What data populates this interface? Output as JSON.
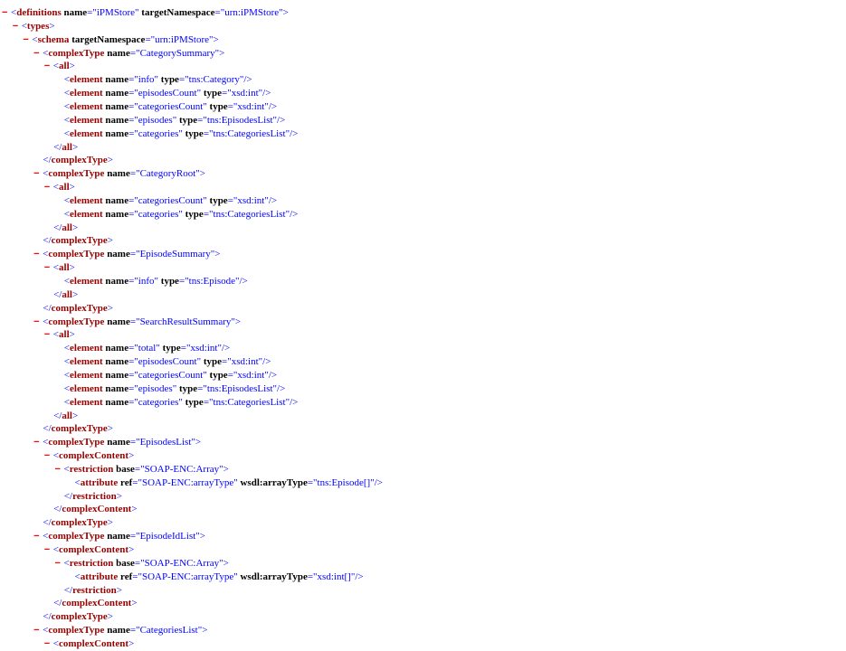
{
  "xml_lines": [
    {
      "d": 0,
      "toggle": true,
      "kind": "open",
      "tag": "definitions",
      "attrs": [
        [
          "name",
          "iPMStore"
        ],
        [
          "targetNamespace",
          "urn:iPMStore"
        ]
      ]
    },
    {
      "d": 1,
      "toggle": true,
      "kind": "open",
      "tag": "types",
      "attrs": []
    },
    {
      "d": 2,
      "toggle": true,
      "kind": "open",
      "tag": "schema",
      "attrs": [
        [
          "targetNamespace",
          "urn:iPMStore"
        ]
      ]
    },
    {
      "d": 3,
      "toggle": true,
      "kind": "open",
      "tag": "complexType",
      "attrs": [
        [
          "name",
          "CategorySummary"
        ]
      ]
    },
    {
      "d": 4,
      "toggle": true,
      "kind": "open",
      "tag": "all",
      "attrs": []
    },
    {
      "d": 5,
      "toggle": false,
      "kind": "empty",
      "tag": "element",
      "attrs": [
        [
          "name",
          "info"
        ],
        [
          "type",
          "tns:Category"
        ]
      ]
    },
    {
      "d": 5,
      "toggle": false,
      "kind": "empty",
      "tag": "element",
      "attrs": [
        [
          "name",
          "episodesCount"
        ],
        [
          "type",
          "xsd:int"
        ]
      ]
    },
    {
      "d": 5,
      "toggle": false,
      "kind": "empty",
      "tag": "element",
      "attrs": [
        [
          "name",
          "categoriesCount"
        ],
        [
          "type",
          "xsd:int"
        ]
      ]
    },
    {
      "d": 5,
      "toggle": false,
      "kind": "empty",
      "tag": "element",
      "attrs": [
        [
          "name",
          "episodes"
        ],
        [
          "type",
          "tns:EpisodesList"
        ]
      ]
    },
    {
      "d": 5,
      "toggle": false,
      "kind": "empty",
      "tag": "element",
      "attrs": [
        [
          "name",
          "categories"
        ],
        [
          "type",
          "tns:CategoriesList"
        ]
      ]
    },
    {
      "d": 4,
      "toggle": false,
      "kind": "close",
      "tag": "all",
      "attrs": []
    },
    {
      "d": 3,
      "toggle": false,
      "kind": "close",
      "tag": "complexType",
      "attrs": []
    },
    {
      "d": 3,
      "toggle": true,
      "kind": "open",
      "tag": "complexType",
      "attrs": [
        [
          "name",
          "CategoryRoot"
        ]
      ]
    },
    {
      "d": 4,
      "toggle": true,
      "kind": "open",
      "tag": "all",
      "attrs": []
    },
    {
      "d": 5,
      "toggle": false,
      "kind": "empty",
      "tag": "element",
      "attrs": [
        [
          "name",
          "categoriesCount"
        ],
        [
          "type",
          "xsd:int"
        ]
      ]
    },
    {
      "d": 5,
      "toggle": false,
      "kind": "empty",
      "tag": "element",
      "attrs": [
        [
          "name",
          "categories"
        ],
        [
          "type",
          "tns:CategoriesList"
        ]
      ]
    },
    {
      "d": 4,
      "toggle": false,
      "kind": "close",
      "tag": "all",
      "attrs": []
    },
    {
      "d": 3,
      "toggle": false,
      "kind": "close",
      "tag": "complexType",
      "attrs": []
    },
    {
      "d": 3,
      "toggle": true,
      "kind": "open",
      "tag": "complexType",
      "attrs": [
        [
          "name",
          "EpisodeSummary"
        ]
      ]
    },
    {
      "d": 4,
      "toggle": true,
      "kind": "open",
      "tag": "all",
      "attrs": []
    },
    {
      "d": 5,
      "toggle": false,
      "kind": "empty",
      "tag": "element",
      "attrs": [
        [
          "name",
          "info"
        ],
        [
          "type",
          "tns:Episode"
        ]
      ]
    },
    {
      "d": 4,
      "toggle": false,
      "kind": "close",
      "tag": "all",
      "attrs": []
    },
    {
      "d": 3,
      "toggle": false,
      "kind": "close",
      "tag": "complexType",
      "attrs": []
    },
    {
      "d": 3,
      "toggle": true,
      "kind": "open",
      "tag": "complexType",
      "attrs": [
        [
          "name",
          "SearchResultSummary"
        ]
      ]
    },
    {
      "d": 4,
      "toggle": true,
      "kind": "open",
      "tag": "all",
      "attrs": []
    },
    {
      "d": 5,
      "toggle": false,
      "kind": "empty",
      "tag": "element",
      "attrs": [
        [
          "name",
          "total"
        ],
        [
          "type",
          "xsd:int"
        ]
      ]
    },
    {
      "d": 5,
      "toggle": false,
      "kind": "empty",
      "tag": "element",
      "attrs": [
        [
          "name",
          "episodesCount"
        ],
        [
          "type",
          "xsd:int"
        ]
      ]
    },
    {
      "d": 5,
      "toggle": false,
      "kind": "empty",
      "tag": "element",
      "attrs": [
        [
          "name",
          "categoriesCount"
        ],
        [
          "type",
          "xsd:int"
        ]
      ]
    },
    {
      "d": 5,
      "toggle": false,
      "kind": "empty",
      "tag": "element",
      "attrs": [
        [
          "name",
          "episodes"
        ],
        [
          "type",
          "tns:EpisodesList"
        ]
      ]
    },
    {
      "d": 5,
      "toggle": false,
      "kind": "empty",
      "tag": "element",
      "attrs": [
        [
          "name",
          "categories"
        ],
        [
          "type",
          "tns:CategoriesList"
        ]
      ]
    },
    {
      "d": 4,
      "toggle": false,
      "kind": "close",
      "tag": "all",
      "attrs": []
    },
    {
      "d": 3,
      "toggle": false,
      "kind": "close",
      "tag": "complexType",
      "attrs": []
    },
    {
      "d": 3,
      "toggle": true,
      "kind": "open",
      "tag": "complexType",
      "attrs": [
        [
          "name",
          "EpisodesList"
        ]
      ]
    },
    {
      "d": 4,
      "toggle": true,
      "kind": "open",
      "tag": "complexContent",
      "attrs": []
    },
    {
      "d": 5,
      "toggle": true,
      "kind": "open",
      "tag": "restriction",
      "attrs": [
        [
          "base",
          "SOAP-ENC:Array"
        ]
      ]
    },
    {
      "d": 6,
      "toggle": false,
      "kind": "empty",
      "tag": "attribute",
      "attrs": [
        [
          "ref",
          "SOAP-ENC:arrayType"
        ],
        [
          "wsdl:arrayType",
          "tns:Episode[]"
        ]
      ]
    },
    {
      "d": 5,
      "toggle": false,
      "kind": "close",
      "tag": "restriction",
      "attrs": []
    },
    {
      "d": 4,
      "toggle": false,
      "kind": "close",
      "tag": "complexContent",
      "attrs": []
    },
    {
      "d": 3,
      "toggle": false,
      "kind": "close",
      "tag": "complexType",
      "attrs": []
    },
    {
      "d": 3,
      "toggle": true,
      "kind": "open",
      "tag": "complexType",
      "attrs": [
        [
          "name",
          "EpisodeIdList"
        ]
      ]
    },
    {
      "d": 4,
      "toggle": true,
      "kind": "open",
      "tag": "complexContent",
      "attrs": []
    },
    {
      "d": 5,
      "toggle": true,
      "kind": "open",
      "tag": "restriction",
      "attrs": [
        [
          "base",
          "SOAP-ENC:Array"
        ]
      ]
    },
    {
      "d": 6,
      "toggle": false,
      "kind": "empty",
      "tag": "attribute",
      "attrs": [
        [
          "ref",
          "SOAP-ENC:arrayType"
        ],
        [
          "wsdl:arrayType",
          "xsd:int[]"
        ]
      ]
    },
    {
      "d": 5,
      "toggle": false,
      "kind": "close",
      "tag": "restriction",
      "attrs": []
    },
    {
      "d": 4,
      "toggle": false,
      "kind": "close",
      "tag": "complexContent",
      "attrs": []
    },
    {
      "d": 3,
      "toggle": false,
      "kind": "close",
      "tag": "complexType",
      "attrs": []
    },
    {
      "d": 3,
      "toggle": true,
      "kind": "open",
      "tag": "complexType",
      "attrs": [
        [
          "name",
          "CategoriesList"
        ]
      ]
    },
    {
      "d": 4,
      "toggle": true,
      "kind": "open",
      "tag": "complexContent",
      "attrs": []
    }
  ],
  "toggle_glyph": "−"
}
